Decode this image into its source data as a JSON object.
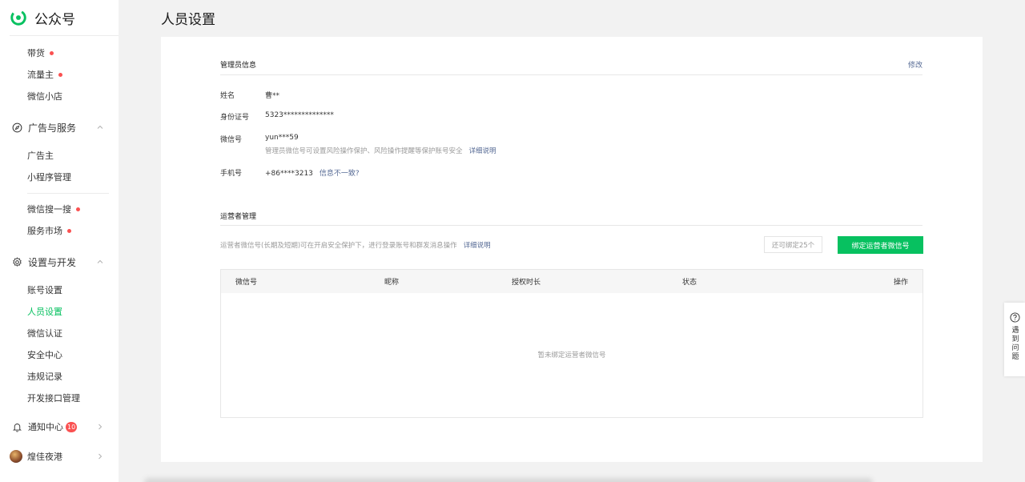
{
  "brand": {
    "name": "公众号"
  },
  "sidebar": {
    "top_items": [
      {
        "label": "带货",
        "dot": true
      },
      {
        "label": "流量主",
        "dot": true
      },
      {
        "label": "微信小店",
        "dot": false
      }
    ],
    "ad_group": {
      "label": "广告与服务"
    },
    "ad_items": [
      {
        "label": "广告主"
      },
      {
        "label": "小程序管理"
      }
    ],
    "search_items": [
      {
        "label": "微信搜一搜",
        "dot": true
      },
      {
        "label": "服务市场",
        "dot": true
      }
    ],
    "settings_group": {
      "label": "设置与开发"
    },
    "settings_items": [
      {
        "label": "账号设置"
      },
      {
        "label": "人员设置",
        "active": true
      },
      {
        "label": "微信认证"
      },
      {
        "label": "安全中心"
      },
      {
        "label": "违规记录"
      },
      {
        "label": "开发接口管理"
      }
    ],
    "notice": {
      "label": "通知中心",
      "count": "10"
    },
    "account": {
      "name": "煌佳夜港"
    }
  },
  "header": {
    "title": "人员设置"
  },
  "admin": {
    "section_title": "管理员信息",
    "edit_label": "修改",
    "name_label": "姓名",
    "name_value": "曹**",
    "id_label": "身份证号",
    "id_value": "5323**************",
    "wechat_label": "微信号",
    "wechat_value": "yun***59",
    "wechat_desc": "管理员微信号可设置风险操作保护、风险操作提醒等保护账号安全",
    "wechat_link": "详细说明",
    "phone_label": "手机号",
    "phone_value": "+86****3213",
    "phone_link": "信息不一致?"
  },
  "operators": {
    "section_title": "运营者管理",
    "desc": "运营者微信号(长期及短期)可在开启安全保护下，进行登录账号和群发消息操作",
    "desc_link": "详细说明",
    "quota": "还可绑定25个",
    "bind_button": "绑定运营者微信号",
    "columns": [
      "微信号",
      "昵称",
      "授权时长",
      "状态",
      "操作"
    ],
    "empty_text": "暂未绑定运营者微信号"
  },
  "help": {
    "label": "遇到问题"
  },
  "colors": {
    "accent": "#07c160",
    "link": "#576b95",
    "alert": "#fa5151"
  }
}
